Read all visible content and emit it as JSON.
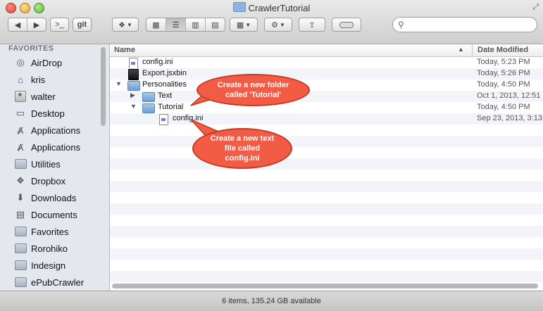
{
  "window": {
    "title": "CrawlerTutorial"
  },
  "toolbar": {
    "terminal_label": ">_",
    "git_label": "git",
    "search": {
      "value": "",
      "placeholder": ""
    }
  },
  "sidebar": {
    "header": "FAVORITES",
    "items": [
      {
        "label": "AirDrop",
        "icon": "airdrop-icon"
      },
      {
        "label": "kris",
        "icon": "home-icon"
      },
      {
        "label": "walter",
        "icon": "home-icon"
      },
      {
        "label": "Desktop",
        "icon": "desktop-icon"
      },
      {
        "label": "Applications",
        "icon": "applications-icon"
      },
      {
        "label": "Applications",
        "icon": "applications-icon"
      },
      {
        "label": "Utilities",
        "icon": "folder-icon"
      },
      {
        "label": "Dropbox",
        "icon": "dropbox-icon"
      },
      {
        "label": "Downloads",
        "icon": "downloads-icon"
      },
      {
        "label": "Documents",
        "icon": "documents-icon"
      },
      {
        "label": "Favorites",
        "icon": "folder-icon"
      },
      {
        "label": "Rorohiko",
        "icon": "folder-icon"
      },
      {
        "label": "Indesign",
        "icon": "folder-icon"
      },
      {
        "label": "ePubCrawler",
        "icon": "folder-icon"
      }
    ]
  },
  "columns": {
    "name": "Name",
    "date": "Date Modified"
  },
  "files": [
    {
      "name": "config.ini",
      "date": "Today, 5:23 PM",
      "kind": "file",
      "depth": 0,
      "disclosure": ""
    },
    {
      "name": "Export.jsxbin",
      "date": "Today, 5:26 PM",
      "kind": "exec",
      "depth": 0,
      "disclosure": ""
    },
    {
      "name": "Personalities",
      "date": "Today, 4:50 PM",
      "kind": "folder",
      "depth": 0,
      "disclosure": "open"
    },
    {
      "name": "Text",
      "date": "Oct 1, 2013, 12:51",
      "kind": "folder",
      "depth": 1,
      "disclosure": "closed"
    },
    {
      "name": "Tutorial",
      "date": "Today, 4:50 PM",
      "kind": "folder",
      "depth": 1,
      "disclosure": "open"
    },
    {
      "name": "config.ini",
      "date": "Sep 23, 2013, 3:13",
      "kind": "file",
      "depth": 2,
      "disclosure": ""
    }
  ],
  "annotations": {
    "folder_note": "Create a new folder called 'Tutorial'",
    "file_note": "Create a new text file called config.ini"
  },
  "status": {
    "text": "6 items, 135.24 GB available"
  },
  "colors": {
    "bubble": "#f25c45",
    "bubble_border": "#c23a26",
    "sidebar_bg": "#e4e8ee",
    "row_alt": "#f1f5fa"
  }
}
